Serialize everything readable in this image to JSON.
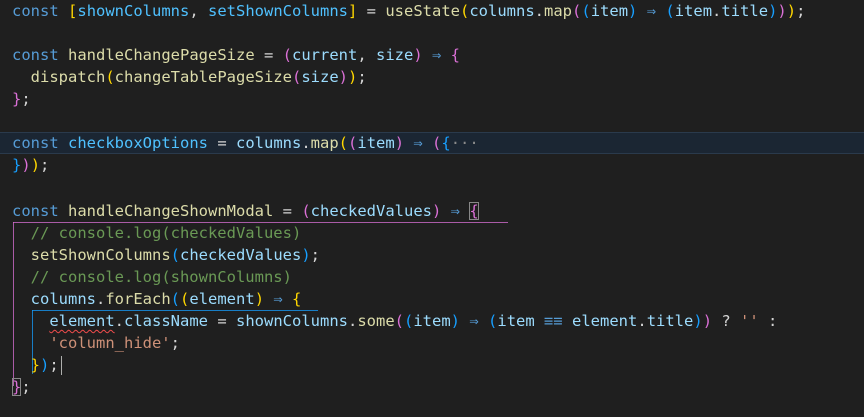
{
  "editor": {
    "line1": {
      "kw": "const",
      "b1open": "[",
      "var1": "shownColumns",
      "comma": ", ",
      "var2": "setShownColumns",
      "b1close": "]",
      "eq": " = ",
      "fn": "useState",
      "p1": "(",
      "obj": "columns",
      "dot": ".",
      "method": "map",
      "p2": "(",
      "p3": "(",
      "param": "item",
      "p3c": ")",
      "arrow": " ⇒ ",
      "p4": "(",
      "ref": "item",
      "dot2": ".",
      "prop": "title",
      "p4c": ")",
      "p2c": ")",
      "p1c": ")",
      "semi": ";"
    },
    "line3": {
      "kw": "const",
      "name": "handleChangePageSize",
      "eq": " = ",
      "p": "(",
      "a1": "current",
      "comma": ", ",
      "a2": "size",
      "pc": ")",
      "arrow": " ⇒ ",
      "brace": "{"
    },
    "line4": {
      "fn": "dispatch",
      "p1": "(",
      "fn2": "changeTablePageSize",
      "p2": "(",
      "arg": "size",
      "p2c": ")",
      "p1c": ")",
      "semi": ";"
    },
    "line5": {
      "brace": "}",
      "semi": ";"
    },
    "line7": {
      "kw": "const",
      "name": "checkboxOptions",
      "eq": " = ",
      "obj": "columns",
      "dot": ".",
      "method": "map",
      "p1": "(",
      "p2": "(",
      "param": "item",
      "p2c": ")",
      "arrow": " ⇒ ",
      "p3": "(",
      "brace": "{",
      "fold": "···"
    },
    "line8": {
      "brace": "}",
      "p3c": ")",
      "p1c": ")",
      "semi": ";"
    },
    "line10": {
      "kw": "const",
      "name": "handleChangeShownModal",
      "eq": " = ",
      "p": "(",
      "param": "checkedValues",
      "pc": ")",
      "arrow": " ⇒ ",
      "brace": "{"
    },
    "line11": {
      "comment": "// console.log(checkedValues)"
    },
    "line12": {
      "fn": "setShownColumns",
      "p": "(",
      "arg": "checkedValues",
      "pc": ")",
      "semi": ";"
    },
    "line13": {
      "comment": "// console.log(shownColumns)"
    },
    "line14": {
      "obj": "columns",
      "dot": ".",
      "method": "forEach",
      "p1": "(",
      "p2": "(",
      "param": "element",
      "p2c": ")",
      "arrow": " ⇒ ",
      "brace": "{"
    },
    "line15": {
      "obj": "element",
      "dot": ".",
      "prop": "className",
      "eq": " = ",
      "ref": "shownColumns",
      "dot2": ".",
      "method": "some",
      "p1": "(",
      "p2": "(",
      "param": "item",
      "p2c": ")",
      "arrow": " ⇒ ",
      "p3": "(",
      "ref2": "item",
      "op": " ≡≡ ",
      "ref3": "element",
      "dot3": ".",
      "prop2": "title",
      "p3c": ")",
      "p1c": ")",
      "tern": " ? ",
      "str1": "''",
      "colon": " :"
    },
    "line16": {
      "str": "'column_hide'",
      "semi": ";"
    },
    "line17": {
      "brace": "}",
      "pc": ")",
      "semi": ";"
    },
    "line18": {
      "brace": "}",
      "semi": ";"
    }
  }
}
